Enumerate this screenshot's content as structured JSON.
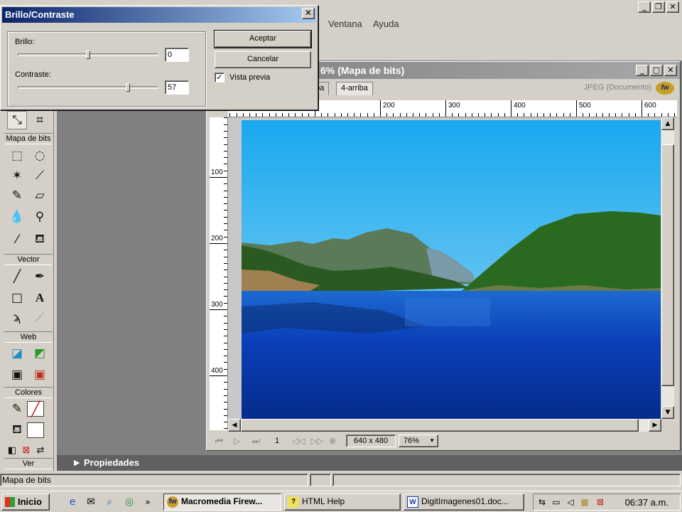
{
  "menubar": {
    "items": [
      "Ventana",
      "Ayuda"
    ]
  },
  "dialog": {
    "title": "Brillo/Contraste",
    "brightness_label": "Brillo:",
    "brightness_value": "0",
    "brightness_fraction": 0.5,
    "contrast_label": "Contraste:",
    "contrast_value": "57",
    "contrast_fraction": 0.785,
    "ok_label": "Aceptar",
    "cancel_label": "Cancelar",
    "preview_label": "Vista previa",
    "preview_checked": true
  },
  "tools": {
    "sections": [
      "Mapa de bits",
      "Vector",
      "Web",
      "Colores",
      "Ver"
    ]
  },
  "document": {
    "title": "6% (Mapa de bits)",
    "tabs": [
      "riba",
      "4-arriba"
    ],
    "format_label": "JPEG (Documento)",
    "ruler_h_labels": [
      "200",
      "300",
      "400",
      "500",
      "600"
    ],
    "ruler_v_labels": [
      "100",
      "200",
      "300",
      "400"
    ],
    "frame": "1",
    "size": "640 x 480",
    "zoom": "76%"
  },
  "properties": {
    "label": "Propiedades"
  },
  "statusbar": {
    "text": "Mapa de bits"
  },
  "taskbar": {
    "start_label": "Inicio",
    "tasks": [
      "Macromedia Firew...",
      "HTML Help",
      "DigitImagenes01.doc..."
    ],
    "clock": "06:37 a.m."
  },
  "colors": {
    "dialog_title_start": "#0a246a",
    "dialog_title_end": "#a6caf0",
    "chrome": "#d4d0c8",
    "workspace": "#808080"
  }
}
